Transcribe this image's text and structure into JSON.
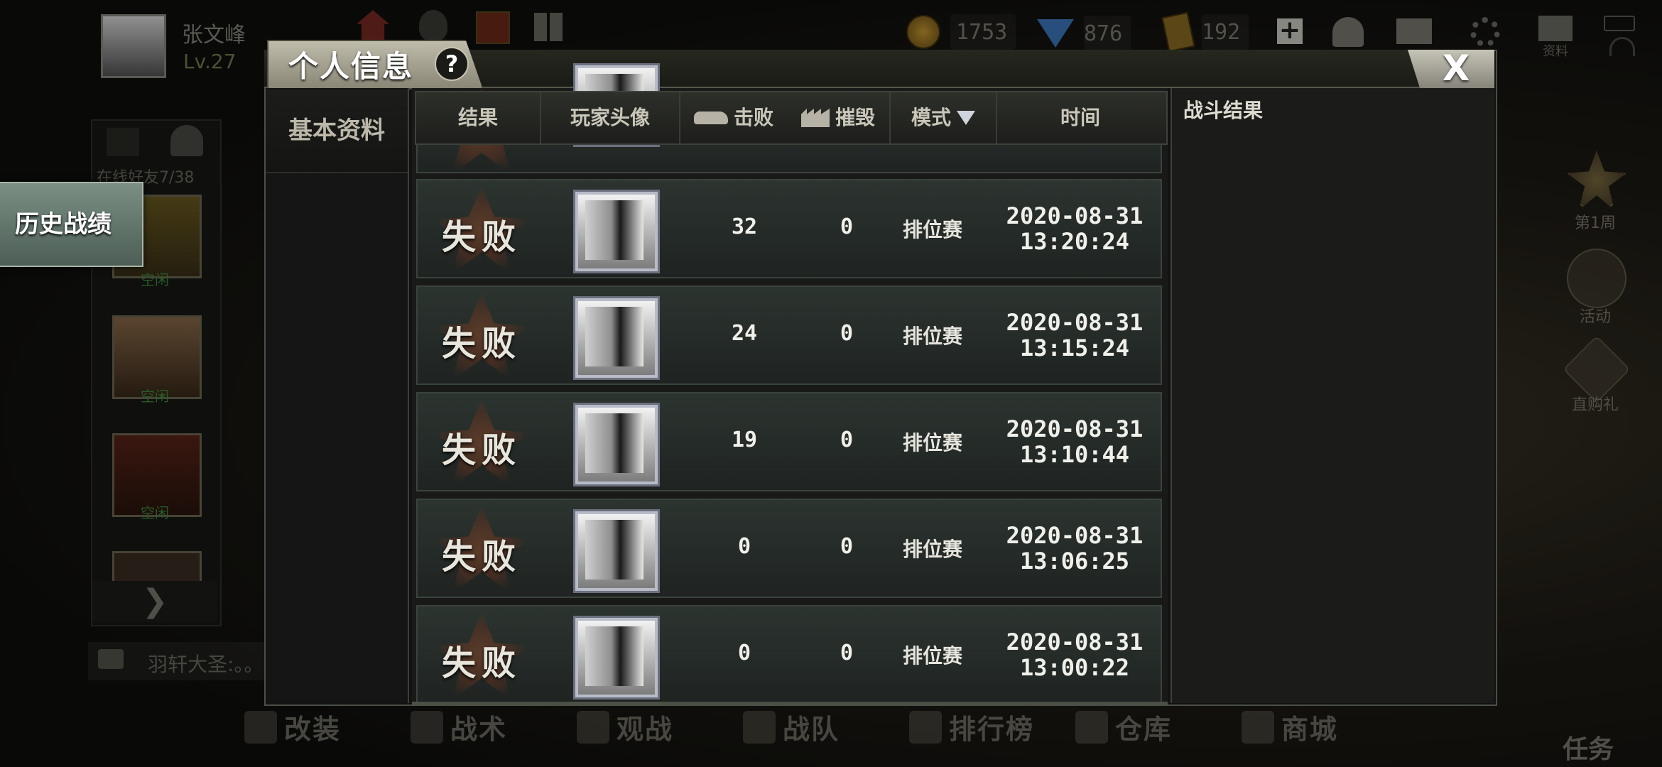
{
  "player": {
    "name": "张文峰",
    "level": "Lv.27"
  },
  "top_nav": {
    "icons": [
      "home-icon",
      "qq-icon",
      "gift-icon",
      "grid-icon"
    ]
  },
  "resources": {
    "gold": "1753",
    "diamonds": "876",
    "tickets": "192"
  },
  "top_right_icons": [
    "plus-icon",
    "friends-icon",
    "mail-icon",
    "gear-icon",
    "book-icon"
  ],
  "top_right_label": "资料",
  "friends": {
    "online": "在线好友7/38",
    "items": [
      {
        "status": "空闲"
      },
      {
        "status": "空闲"
      },
      {
        "status": "空闲"
      }
    ]
  },
  "chat": {
    "text": "羽轩大圣:。。"
  },
  "right_side": {
    "items": [
      {
        "label": "第1周"
      },
      {
        "label": "活动"
      },
      {
        "label": "直购礼"
      }
    ],
    "task": "任务"
  },
  "bottom_nav": {
    "items": [
      {
        "label": "改装",
        "icon": "wrench-icon"
      },
      {
        "label": "战术",
        "icon": "skull-icon"
      },
      {
        "label": "观战",
        "icon": "star-icon"
      },
      {
        "label": "战队",
        "icon": "shield-icon"
      },
      {
        "label": "排行榜",
        "icon": "trophy-icon"
      },
      {
        "label": "仓库",
        "icon": "warehouse-icon"
      },
      {
        "label": "商城",
        "icon": "shop-icon"
      }
    ]
  },
  "dialog": {
    "title": "个人信息",
    "help": "?",
    "close": "X",
    "tabs": [
      {
        "label": "基本资料"
      },
      {
        "label": "历史战绩"
      }
    ],
    "active_tab": "历史战绩",
    "table": {
      "headers": {
        "result": "结果",
        "avatar": "玩家头像",
        "kills": "击败",
        "destroy": "摧毁",
        "mode": "模式",
        "time": "时间"
      },
      "rows": [
        {
          "result": "失败",
          "kills": "32",
          "destroy": "0",
          "mode": "排位赛",
          "date": "2020-08-31",
          "time": "13:20:24"
        },
        {
          "result": "失败",
          "kills": "24",
          "destroy": "0",
          "mode": "排位赛",
          "date": "2020-08-31",
          "time": "13:15:24"
        },
        {
          "result": "失败",
          "kills": "19",
          "destroy": "0",
          "mode": "排位赛",
          "date": "2020-08-31",
          "time": "13:10:44"
        },
        {
          "result": "失败",
          "kills": "0",
          "destroy": "0",
          "mode": "排位赛",
          "date": "2020-08-31",
          "time": "13:06:25"
        },
        {
          "result": "失败",
          "kills": "0",
          "destroy": "0",
          "mode": "排位赛",
          "date": "2020-08-31",
          "time": "13:00:22"
        }
      ]
    },
    "result_panel": {
      "title": "战斗结果"
    }
  }
}
